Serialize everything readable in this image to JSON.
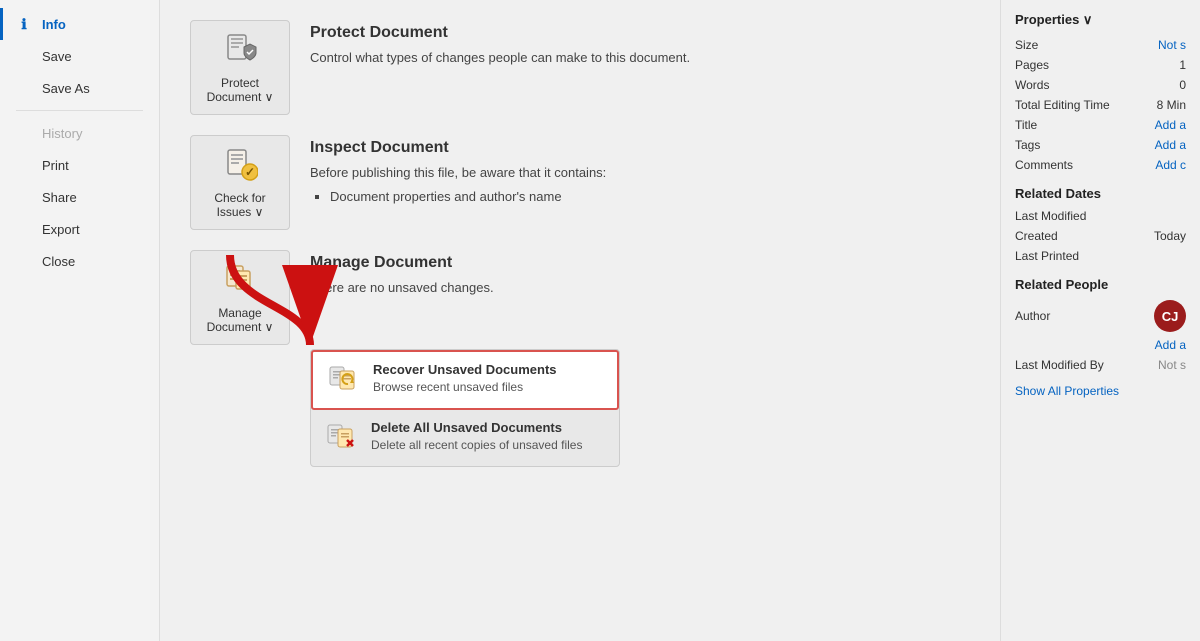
{
  "sidebar": {
    "items": [
      {
        "id": "info",
        "label": "Info",
        "icon": "ℹ",
        "active": true,
        "disabled": false
      },
      {
        "id": "save",
        "label": "Save",
        "icon": "💾",
        "active": false,
        "disabled": false
      },
      {
        "id": "save-as",
        "label": "Save As",
        "icon": "📁",
        "active": false,
        "disabled": false
      },
      {
        "id": "history",
        "label": "History",
        "icon": "🕐",
        "active": false,
        "disabled": true
      },
      {
        "id": "print",
        "label": "Print",
        "icon": "🖨",
        "active": false,
        "disabled": false
      },
      {
        "id": "share",
        "label": "Share",
        "icon": "↗",
        "active": false,
        "disabled": false
      },
      {
        "id": "export",
        "label": "Export",
        "icon": "📤",
        "active": false,
        "disabled": false
      },
      {
        "id": "close",
        "label": "Close",
        "icon": "✕",
        "active": false,
        "disabled": false
      }
    ]
  },
  "sections": {
    "protect": {
      "btn_label": "Protect\nDocument ∨",
      "title": "Protect Document",
      "desc": "Control what types of changes people can make to this document."
    },
    "inspect": {
      "btn_label": "Check for\nIssues ∨",
      "title": "Inspect Document",
      "desc": "Before publishing this file, be aware that it contains:",
      "bullets": [
        "Document properties and author's name"
      ]
    },
    "manage": {
      "btn_label": "Manage\nDocument ∨",
      "title": "Manage Document",
      "desc": "There are no unsaved changes.",
      "dropdown": {
        "items": [
          {
            "id": "recover",
            "title": "Recover Unsaved Documents",
            "desc": "Browse recent unsaved files",
            "highlighted": true
          },
          {
            "id": "delete",
            "title": "Delete All Unsaved Documents",
            "desc": "Delete all recent copies of unsaved files",
            "highlighted": false
          }
        ]
      }
    }
  },
  "properties": {
    "title": "Properties ∨",
    "rows": [
      {
        "label": "Size",
        "value": "Not s",
        "value_style": "blue"
      },
      {
        "label": "Pages",
        "value": "1",
        "value_style": "black"
      },
      {
        "label": "Words",
        "value": "0",
        "value_style": "black"
      },
      {
        "label": "Total Editing Time",
        "value": "8 Min",
        "value_style": "black"
      },
      {
        "label": "Title",
        "value": "Add a",
        "value_style": "blue"
      },
      {
        "label": "Tags",
        "value": "Add a",
        "value_style": "blue"
      },
      {
        "label": "Comments",
        "value": "Add c",
        "value_style": "blue"
      }
    ],
    "related_dates_heading": "Related Dates",
    "related_dates": [
      {
        "label": "Last Modified",
        "value": "",
        "value_style": "blue"
      },
      {
        "label": "Created",
        "value": "Today",
        "value_style": "black"
      },
      {
        "label": "Last Printed",
        "value": "",
        "value_style": "blue"
      }
    ],
    "related_people_heading": "Related People",
    "related_people": [
      {
        "label": "Author",
        "value": ""
      }
    ],
    "author_initials": "CJ",
    "author_add": "Add a",
    "last_modified_by_label": "Last Modified By",
    "last_modified_by_value": "Not s",
    "show_all": "Show All Properties"
  }
}
